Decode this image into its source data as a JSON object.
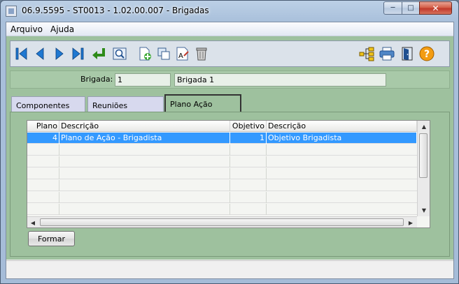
{
  "window": {
    "title": "06.9.5595 - ST0013 - 1.02.00.007 - Brigadas"
  },
  "menu": {
    "items": [
      "Arquivo",
      "Ajuda"
    ]
  },
  "toolbar": {
    "icons": [
      "first-record-icon",
      "previous-record-icon",
      "next-record-icon",
      "last-record-icon",
      "enter-icon",
      "search-icon",
      "new-record-icon",
      "copy-icon",
      "edit-icon",
      "delete-icon",
      "tree-icon",
      "print-icon",
      "exit-door-icon",
      "help-icon"
    ],
    "help_glyph": "?"
  },
  "form": {
    "brigada_label": "Brigada:",
    "brigada_code": "1",
    "brigada_name": "Brigada 1"
  },
  "tabs": [
    {
      "label": "Componentes",
      "active": false
    },
    {
      "label": "Reuniões",
      "active": false
    },
    {
      "label": "Plano Ação",
      "active": true
    }
  ],
  "grid": {
    "columns": [
      "Plano",
      "Descrição",
      "Objetivo",
      "Descrição"
    ],
    "rows": [
      {
        "plano": "4",
        "descricao": "Plano de Ação - Brigadista",
        "objetivo": "1",
        "objetivo_descricao": "Objetivo Brigadista",
        "selected": true
      }
    ]
  },
  "buttons": {
    "formar": "Formar"
  },
  "colors": {
    "panel_green": "#9ec19e",
    "selection_blue": "#3399ff",
    "toolbar_blue": "#1f78d1",
    "help_orange": "#f39c12"
  }
}
